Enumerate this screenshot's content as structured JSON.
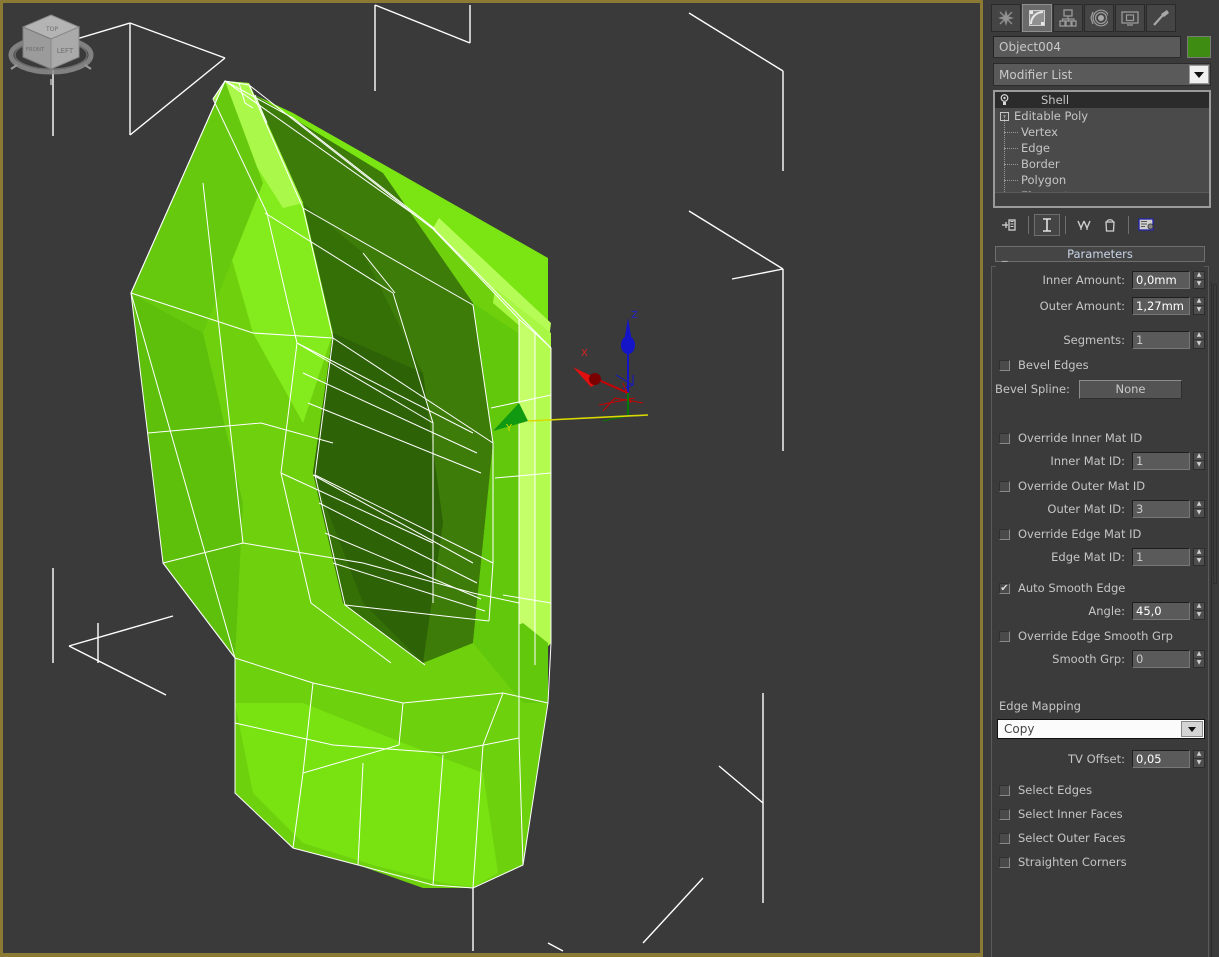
{
  "app": {
    "viewport_label": "",
    "viewcube_faces": [
      "LEFT",
      "TOP",
      "FRONT"
    ],
    "axis_labels": {
      "x": "X",
      "y": "Y",
      "z": "Z"
    }
  },
  "command_panel": {
    "tabs": [
      {
        "name": "create-tab",
        "icon": "star-icon",
        "active": false
      },
      {
        "name": "modify-tab",
        "icon": "arc-bend-icon",
        "active": true
      },
      {
        "name": "hierarchy-tab",
        "icon": "hierarchy-tree-icon",
        "active": false
      },
      {
        "name": "motion-tab",
        "icon": "motion-rings-icon",
        "active": false
      },
      {
        "name": "display-tab",
        "icon": "monitor-icon",
        "active": false
      },
      {
        "name": "utilities-tab",
        "icon": "hammer-icon",
        "active": false
      }
    ],
    "object_name": "Object004",
    "object_color": "#3f8c12",
    "modifier_list_label": "Modifier List",
    "stack": [
      {
        "label": "Shell",
        "type": "modifier",
        "selected": true,
        "icon": "lightbulb-icon"
      },
      {
        "label": "Editable Poly",
        "type": "base",
        "selected": false,
        "expander": "-"
      },
      {
        "label": "Vertex",
        "type": "sub"
      },
      {
        "label": "Edge",
        "type": "sub"
      },
      {
        "label": "Border",
        "type": "sub"
      },
      {
        "label": "Polygon",
        "type": "sub"
      },
      {
        "label": "Element",
        "type": "sub"
      }
    ],
    "stack_buttons": [
      {
        "name": "pin-stack-button",
        "icon": "pin-icon"
      },
      {
        "name": "show-end-result-button",
        "icon": "show-end-result-icon",
        "active": true
      },
      {
        "name": "make-unique-button",
        "icon": "make-unique-icon"
      },
      {
        "name": "remove-modifier-button",
        "icon": "trash-icon"
      },
      {
        "name": "configure-modifier-sets-button",
        "icon": "configure-icon"
      }
    ]
  },
  "parameters": {
    "rollout_title": "Parameters",
    "collapse_glyph": "_",
    "inner_amount": {
      "label": "Inner Amount:",
      "value": "0,0mm"
    },
    "outer_amount": {
      "label": "Outer Amount:",
      "value": "1,27mm"
    },
    "segments": {
      "label": "Segments:",
      "value": "1"
    },
    "bevel_edges": {
      "label": "Bevel Edges",
      "checked": false
    },
    "bevel_spline": {
      "label": "Bevel Spline:",
      "button": "None"
    },
    "override_inner_mat_id": {
      "label": "Override Inner Mat ID",
      "checked": false
    },
    "inner_mat_id": {
      "label": "Inner Mat ID:",
      "value": "1"
    },
    "override_outer_mat_id": {
      "label": "Override Outer Mat ID",
      "checked": false
    },
    "outer_mat_id": {
      "label": "Outer Mat ID:",
      "value": "3"
    },
    "override_edge_mat_id": {
      "label": "Override Edge Mat ID",
      "checked": false
    },
    "edge_mat_id": {
      "label": "Edge Mat ID:",
      "value": "1"
    },
    "auto_smooth_edge": {
      "label": "Auto Smooth Edge",
      "checked": true
    },
    "angle": {
      "label": "Angle:",
      "value": "45,0"
    },
    "override_edge_smooth_grp": {
      "label": "Override Edge Smooth Grp",
      "checked": false
    },
    "smooth_grp": {
      "label": "Smooth Grp:",
      "value": "0"
    },
    "edge_mapping": {
      "label": "Edge Mapping",
      "value": "Copy"
    },
    "tv_offset": {
      "label": "TV Offset:",
      "value": "0,05"
    },
    "select_edges": {
      "label": "Select Edges",
      "checked": false
    },
    "select_inner_faces": {
      "label": "Select Inner Faces",
      "checked": false
    },
    "select_outer_faces": {
      "label": "Select Outer Faces",
      "checked": false
    },
    "straighten_corners": {
      "label": "Straighten Corners",
      "checked": false
    }
  },
  "colors": {
    "viewport_bg": "#3a3a3a",
    "viewport_border_active": "#8a7a33",
    "panel_bg": "#3b3b3b",
    "mesh_light": "#77dd11",
    "mesh_mid": "#5fbc0c",
    "mesh_dark": "#3c7a08",
    "mesh_darker": "#2f6206",
    "mesh_highlight": "#9bf432",
    "wireframe": "#ffffff",
    "axis_x": "#cc0000",
    "axis_y": "#008800",
    "axis_z": "#0000cc"
  }
}
